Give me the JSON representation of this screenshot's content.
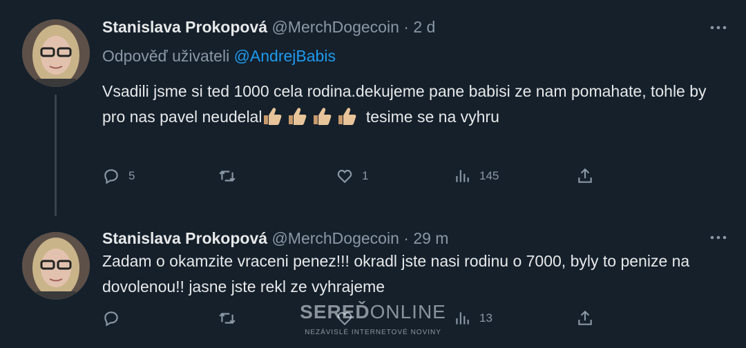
{
  "tweets": [
    {
      "name": "Stanislava Prokopová",
      "handle": "@MerchDogecoin",
      "dot": "·",
      "time": "2 d",
      "reply_prefix": "Odpověď uživateli",
      "reply_mention": "@AndrejBabis",
      "text_part1": "Vsadili jsme si ted 1000 cela rodina.dekujeme pane babisi ze nam pomahate, tohle by pro nas pavel neudelal",
      "emoji": [
        "thumbs-up-emoji",
        "thumbs-up-emoji",
        "thumbs-up-emoji",
        "thumbs-up-emoji"
      ],
      "text_part2": " tesime se na vyhru",
      "replies": "5",
      "retweets": "",
      "likes": "1",
      "views": "145"
    },
    {
      "name": "Stanislava Prokopová",
      "handle": "@MerchDogecoin",
      "dot": "·",
      "time": "29 m",
      "text": "Zadam o okamzite vraceni penez!!! okradl jste nasi rodinu o 7000, byly to penize na dovolenou!! jasne jste rekl ze vyhrajeme",
      "replies": "",
      "retweets": "",
      "likes": "",
      "views": "13"
    }
  ],
  "watermark": {
    "brand_bold": "SEREĎ",
    "brand_light": "ONLINE",
    "tagline": "NEZÁVISLÉ INTERNETOVÉ NOVINY"
  },
  "colors": {
    "background": "#15202b",
    "text": "#e7e9ea",
    "secondary": "#8b98a5",
    "link": "#1d9bf0"
  },
  "icons": [
    "reply-icon",
    "retweet-icon",
    "like-icon",
    "views-icon",
    "share-icon",
    "more-icon"
  ]
}
